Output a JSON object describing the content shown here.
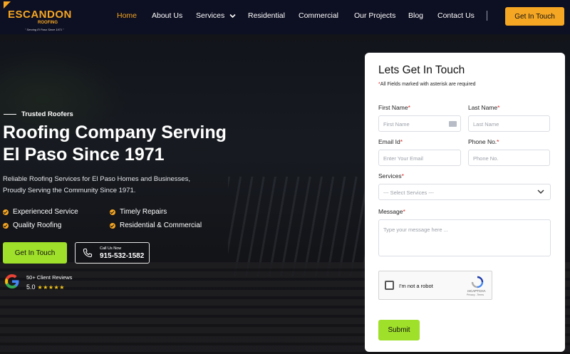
{
  "brand": {
    "name": "ESCANDON",
    "sub": "ROOFING",
    "tagline": "\" Serving El Paso Since 1971 \""
  },
  "nav": {
    "items": [
      "Home",
      "About Us",
      "Services",
      "Residential",
      "Commercial",
      "Our Projects",
      "Blog",
      "Contact Us"
    ],
    "active": "Home",
    "cta": "Get In Touch"
  },
  "hero": {
    "eyebrow": "Trusted Roofers",
    "title_line1": "Roofing Company Serving",
    "title_line2": "El Paso Since 1971",
    "desc_line1": "Reliable Roofing Services for El Paso Homes and Businesses,",
    "desc_line2": "Proudly Serving the Community Since 1971.",
    "features": [
      "Experienced Service",
      "Timely Repairs",
      "Quality Roofing",
      "Residential & Commercial"
    ],
    "cta_button": "Get In Touch",
    "call_label": "Call Us Now",
    "phone": "915-532-1582",
    "reviews_label": "50+ Client Reviews",
    "rating": "5.0",
    "stars": "★★★★★"
  },
  "form": {
    "title": "Lets Get In Touch",
    "note": "All Fields marked with asterisk are required",
    "first_name_label": "First Name",
    "first_name_placeholder": "First Name",
    "last_name_label": "Last Name",
    "last_name_placeholder": "Last Name",
    "email_label": "Email Id",
    "email_placeholder": "Enter Your Email",
    "phone_label": "Phone No.",
    "phone_placeholder": "Phone No.",
    "services_label": "Services",
    "services_selected": "--- Select Services ---",
    "message_label": "Message",
    "message_placeholder": "Type your message here ...",
    "captcha_label": "I'm not a robot",
    "captcha_brand": "reCAPTCHA",
    "captcha_links": "Privacy - Terms",
    "submit": "Submit"
  },
  "colors": {
    "accent": "#f5a623",
    "green": "#9fe02a",
    "header_bg": "#0d0f22"
  }
}
